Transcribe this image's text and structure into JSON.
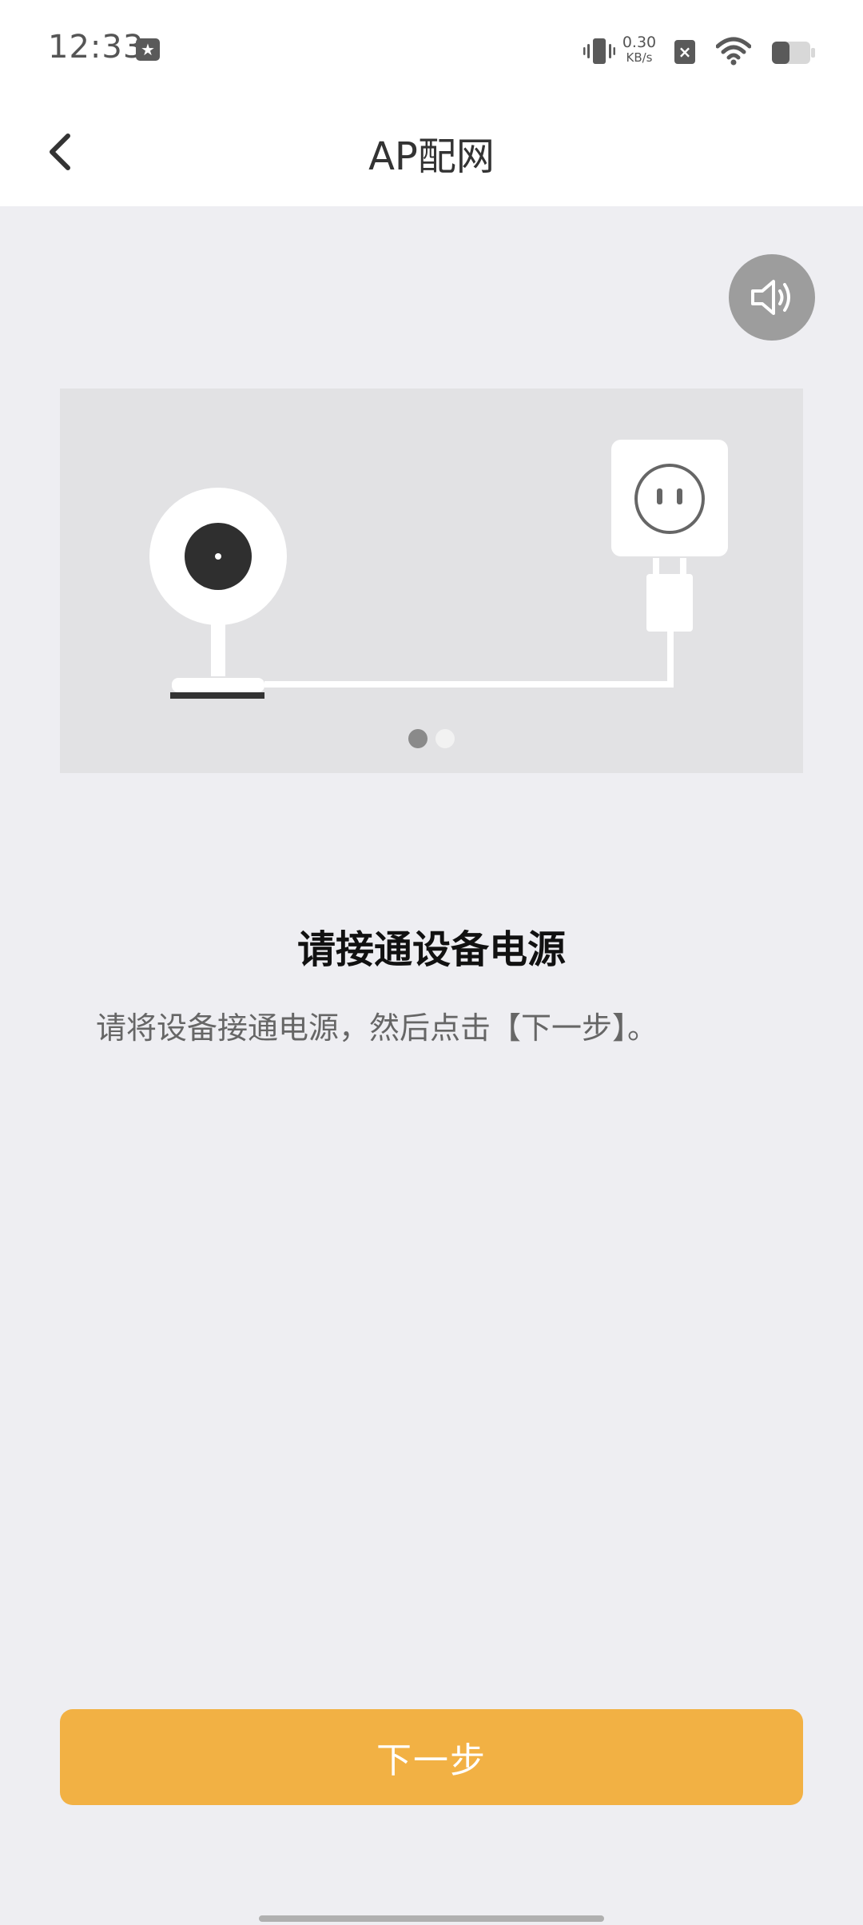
{
  "status_bar": {
    "time": "12:33",
    "notification_icon": "star-badge-icon",
    "net_speed_value": "0.30",
    "net_speed_unit": "KB/s",
    "icons": [
      "vibrate-icon",
      "no-sim-icon",
      "wifi-icon",
      "battery-icon"
    ]
  },
  "header": {
    "title": "AP配网",
    "back_icon": "chevron-left-icon"
  },
  "sound_button": {
    "icon": "speaker-icon"
  },
  "illustration": {
    "description_icons": [
      "camera-icon",
      "power-outlet-icon",
      "power-plug-icon"
    ],
    "pager": {
      "total": 2,
      "active": 1
    }
  },
  "step": {
    "title": "请接通设备电源",
    "description": "请将设备接通电源，然后点击【下一步】。"
  },
  "next_button": {
    "label": "下一步"
  },
  "colors": {
    "accent": "#f2b144",
    "background": "#eeeef2",
    "header_bg": "#ffffff",
    "illustration_bg": "#e2e2e4"
  }
}
